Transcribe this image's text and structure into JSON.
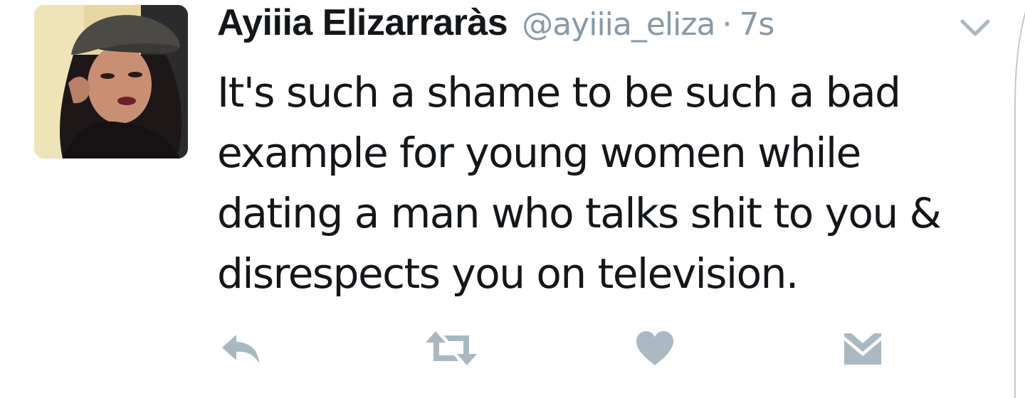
{
  "tweet": {
    "display_name": "Ayiiia Elizarraràs",
    "handle": "@ayiiia_eliza",
    "separator": "·",
    "timestamp": "7s",
    "text": "It's such a shame to be such a bad\nexample for young women while\ndating a man who talks shit to you &\ndisrespects you on television."
  },
  "actions": {
    "icons": [
      "reply-icon",
      "retweet-icon",
      "like-icon",
      "direct-message-icon"
    ],
    "icon_color": "#aab8c2"
  },
  "colors": {
    "name": "#14171a",
    "secondary": "#8899a6",
    "text": "#14171a"
  }
}
